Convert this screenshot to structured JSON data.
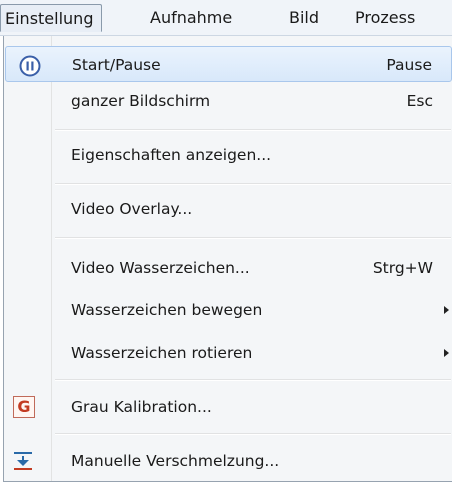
{
  "menubar": {
    "items": [
      {
        "label": "Einstellung"
      },
      {
        "label": "Aufnahme"
      },
      {
        "label": "Bild"
      },
      {
        "label": "Prozess"
      }
    ]
  },
  "menu": {
    "start_pause": {
      "label": "Start/Pause",
      "shortcut": "Pause",
      "icon": "pause-circle-icon"
    },
    "fullscreen": {
      "label": "ganzer Bildschirm",
      "shortcut": "Esc"
    },
    "properties": {
      "label": "Eigenschaften anzeigen..."
    },
    "video_overlay": {
      "label": "Video Overlay..."
    },
    "watermark": {
      "label": "Video Wasserzeichen...",
      "shortcut": "Strg+W"
    },
    "watermark_move": {
      "label": "Wasserzeichen bewegen"
    },
    "watermark_rotate": {
      "label": "Wasserzeichen rotieren"
    },
    "gray_calibration": {
      "label": "Grau Kalibration...",
      "icon": "grau-g-icon",
      "icon_letter": "G"
    },
    "manual_merge": {
      "label": "Manuelle Verschmelzung...",
      "icon": "merge-down-icon"
    }
  },
  "colors": {
    "highlight": "#d8e8fa",
    "grau_icon": "#c23b22",
    "pause_icon": "#3a5fa8",
    "merge_icon": "#2a6aa8"
  }
}
